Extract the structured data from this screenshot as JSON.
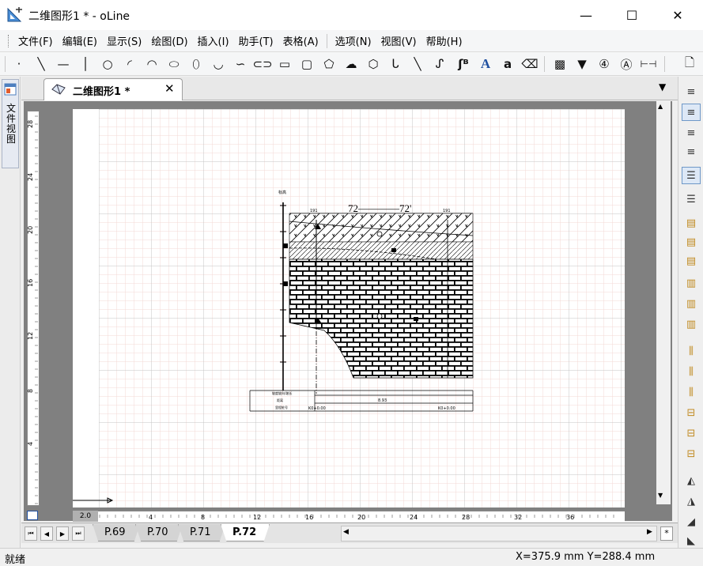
{
  "window": {
    "title": "二维图形1 * - oLine",
    "minimize": "—",
    "maximize": "☐",
    "close": "✕"
  },
  "menu": {
    "items": [
      "文件(F)",
      "编辑(E)",
      "显示(S)",
      "绘图(D)",
      "插入(I)",
      "助手(T)",
      "表格(A)",
      "选项(N)",
      "视图(V)",
      "帮助(H)"
    ]
  },
  "toolbar": {
    "icons": [
      "point-icon",
      "line-icon",
      "hline-icon",
      "vline-icon",
      "circle-icon",
      "arc-icon",
      "arc2-icon",
      "ellipse-arc-icon",
      "ellipse-icon",
      "curve-icon",
      "curve2-icon",
      "oval-icon",
      "rectangle-icon",
      "rounded-rect-icon",
      "polyline-icon",
      "cloud-icon",
      "polygon-icon",
      "spline-icon",
      "spline2-icon",
      "spline3-icon",
      "text-a-icon",
      "text-small-a-icon",
      "eraser-icon",
      "hatch-icon",
      "elevation-icon",
      "north-icon",
      "compass-icon",
      "dimension-icon",
      "new-page-icon"
    ],
    "glyphs": [
      "·",
      "╲",
      "—",
      "│",
      "○",
      "◜",
      "◠",
      "⬭",
      "⬯",
      "◡",
      "∽",
      "⊂⊃",
      "▭",
      "▢",
      "⬠",
      "☁",
      "⬡",
      "ᒐ",
      "╲",
      "ᔑ",
      "A",
      "a",
      "⌫",
      "▩",
      "▼",
      "④",
      "Ⓐ",
      "⊢⊣",
      "🗋"
    ],
    "text_a_label": "A",
    "text_small_a_label": "a"
  },
  "left_panel": {
    "tab_label": "文件视图"
  },
  "doc_tab": {
    "label": "二维图形1 *",
    "close": "✕",
    "dropdown": "▼"
  },
  "rulers": {
    "vertical_labels": [
      "28",
      "24",
      "20",
      "16",
      "12",
      "8",
      "4"
    ],
    "horizontal_labels": [
      "2.0",
      "4",
      "8",
      "12",
      "16",
      "20",
      "24",
      "28",
      "32",
      "36"
    ]
  },
  "drawing": {
    "section_label": "72————72'",
    "header_left": "191",
    "header_right": "191",
    "table_row1": "坡度坡向/坡长",
    "table_row2": "距离",
    "table_row3": "里程桩号",
    "table_value_mid": "8.93",
    "table_left_station": "K0+0.00",
    "table_right_station": "K0+0.00"
  },
  "sheets": {
    "tabs": [
      "P.69",
      "P.70",
      "P.71",
      "P.72"
    ],
    "active": "P.72",
    "nav": [
      "⏮",
      "◀",
      "▶",
      "⏭"
    ]
  },
  "status": {
    "left": "就绪",
    "coords": "X=375.9 mm  Y=288.4 mm"
  },
  "colors": {
    "grid_minor": "#f3d9d6",
    "grid_major": "#c4c4c4",
    "accent_blue": "#2050a0",
    "selected_bg": "#dde8f6"
  }
}
